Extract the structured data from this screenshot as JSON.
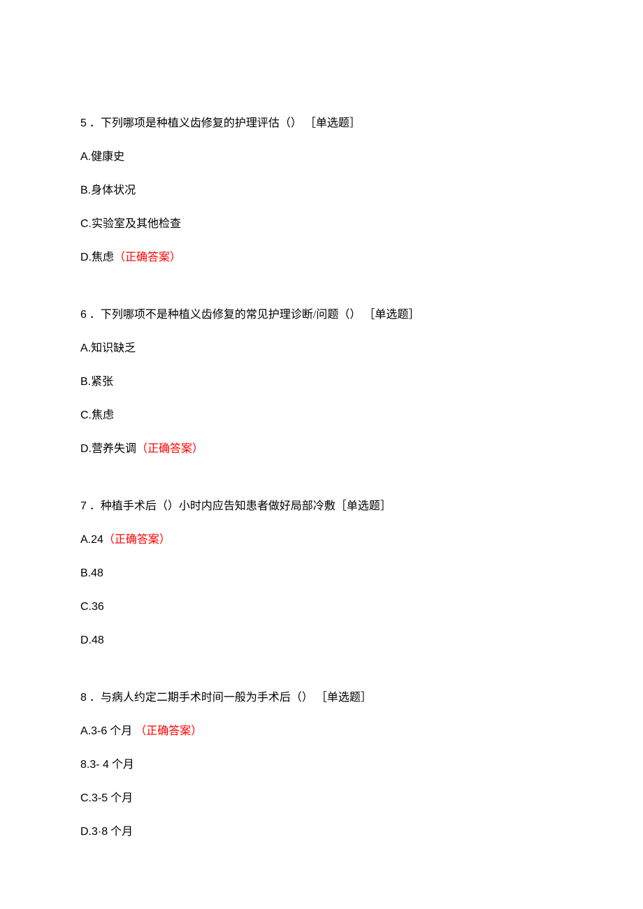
{
  "questions": [
    {
      "num": "5",
      "stem_cn": " ．下列哪项是种植义齿修复的护理评估（） ［单选题］",
      "options": [
        {
          "label_latin": "A.",
          "label_cn": "健康史",
          "correct_cn": ""
        },
        {
          "label_latin": "B.",
          "label_cn": "身体状况",
          "correct_cn": ""
        },
        {
          "label_latin": "C.",
          "label_cn": "实验室及其他检查",
          "correct_cn": ""
        },
        {
          "label_latin": "D.",
          "label_cn": "焦虑",
          "correct_cn": "（正确答案）"
        }
      ]
    },
    {
      "num": "6",
      "stem_cn": " ．下列哪项不是种植义齿修复的常见护理诊断/问题（） ［单选题］",
      "options": [
        {
          "label_latin": "A.",
          "label_cn": "知识缺乏",
          "correct_cn": ""
        },
        {
          "label_latin": "B.",
          "label_cn": "紧张",
          "correct_cn": ""
        },
        {
          "label_latin": "C.",
          "label_cn": "焦虑",
          "correct_cn": ""
        },
        {
          "label_latin": "D.",
          "label_cn": "营养失调",
          "correct_cn": "（正确答案）"
        }
      ]
    },
    {
      "num": "7",
      "stem_cn": " ．种植手术后（）小时内应告知患者做好局部冷敷［单选题］",
      "options": [
        {
          "label_latin": "A.24",
          "label_cn": "",
          "correct_cn": "（正确答案）"
        },
        {
          "label_latin": "B.48",
          "label_cn": "",
          "correct_cn": ""
        },
        {
          "label_latin": "C.36",
          "label_cn": "",
          "correct_cn": ""
        },
        {
          "label_latin": "D.48",
          "label_cn": "",
          "correct_cn": ""
        }
      ]
    },
    {
      "num": "8",
      "stem_cn": " ．与病人约定二期手术时间一般为手术后（） ［单选题］",
      "options": [
        {
          "label_latin": "A.3-6",
          "label_cn": " 个月 ",
          "correct_cn": "（正确答案）"
        },
        {
          "label_latin": "8.3-   4",
          "label_cn": " 个月",
          "correct_cn": ""
        },
        {
          "label_latin": "C.3-5",
          "label_cn": " 个月",
          "correct_cn": ""
        },
        {
          "label_latin": "D.3·8",
          "label_cn": " 个月",
          "correct_cn": ""
        }
      ]
    }
  ]
}
